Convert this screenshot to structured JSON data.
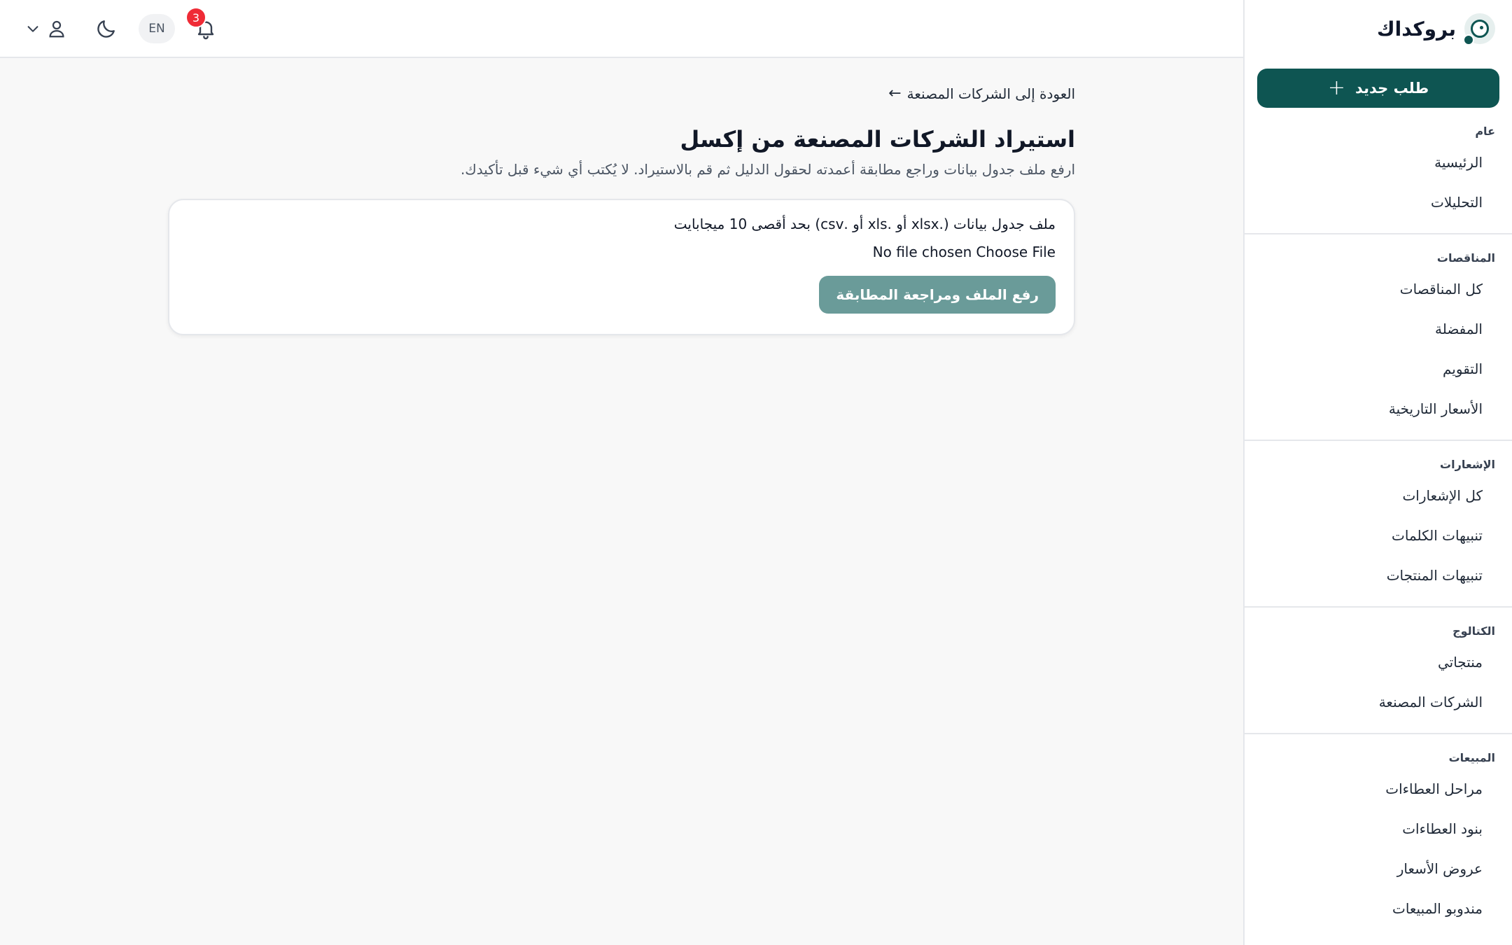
{
  "brand": {
    "name": "بروكداك"
  },
  "colors": {
    "primary": "#0e5552",
    "badge": "#ef2b36",
    "button_disabled": "#6a9b99"
  },
  "topbar": {
    "language": "EN",
    "notifications_count": "3",
    "icons": [
      "chevron-down-icon",
      "user-icon",
      "moon-icon",
      "bell-icon"
    ]
  },
  "sidebar": {
    "new_request": "طلب جديد",
    "sections": [
      {
        "heading": "عام",
        "items": [
          "الرئيسية",
          "التحليلات"
        ]
      },
      {
        "heading": "المناقصات",
        "items": [
          "كل المناقصات",
          "المفضلة",
          "التقويم",
          "الأسعار التاريخية"
        ]
      },
      {
        "heading": "الإشعارات",
        "items": [
          "كل الإشعارات",
          "تنبيهات الكلمات",
          "تنبيهات المنتجات"
        ]
      },
      {
        "heading": "الكتالوج",
        "items": [
          "منتجاتي",
          "الشركات المصنعة"
        ]
      },
      {
        "heading": "المبيعات",
        "items": [
          "مراحل العطاءات",
          "بنود العطاءات",
          "عروض الأسعار",
          "مندوبو المبيعات"
        ]
      }
    ]
  },
  "main": {
    "back_link": "العودة إلى الشركات المصنعة",
    "title": "استيراد الشركات المصنعة من إكسل",
    "subtitle": "ارفع ملف جدول بيانات وراجع مطابقة أعمدته لحقول الدليل ثم قم بالاستيراد. لا يُكتب أي شيء قبل تأكيدك.",
    "card": {
      "field_label": "ملف جدول بيانات (.xlsx أو .xls أو .csv) بحد أقصى 10 ميجابايت",
      "choose_file": "Choose File",
      "no_file": "No file chosen",
      "upload_button": "رفع الملف ومراجعة المطابقة"
    }
  }
}
